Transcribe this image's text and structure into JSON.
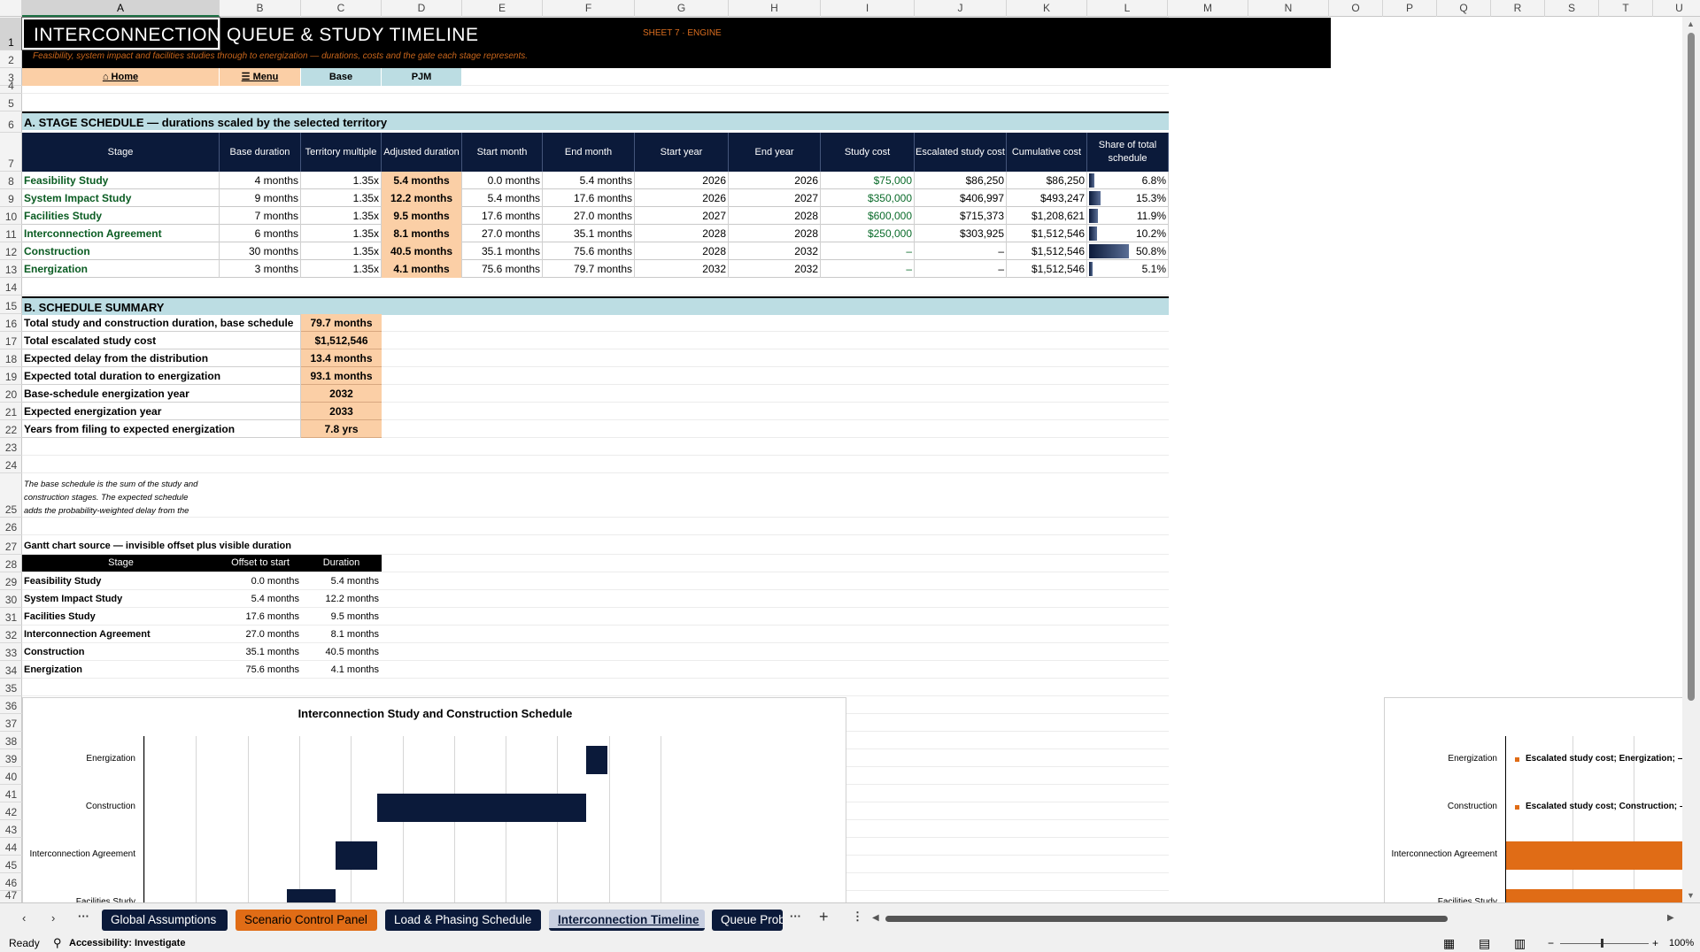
{
  "columns": [
    "A",
    "B",
    "C",
    "D",
    "E",
    "F",
    "G",
    "H",
    "I",
    "J",
    "K",
    "L",
    "M",
    "N",
    "O",
    "P",
    "Q",
    "R",
    "S",
    "T",
    "U"
  ],
  "rows": [
    "1",
    "2",
    "3",
    "4",
    "5",
    "6",
    "7",
    "8",
    "9",
    "10",
    "11",
    "12",
    "13",
    "14",
    "15",
    "16",
    "17",
    "18",
    "19",
    "20",
    "21",
    "22",
    "23",
    "24",
    "25",
    "26",
    "27",
    "28",
    "29",
    "30",
    "31",
    "32",
    "33",
    "34",
    "35",
    "36",
    "37",
    "38",
    "39",
    "40",
    "41",
    "42",
    "43",
    "44",
    "45",
    "46",
    "47"
  ],
  "header": {
    "title": "INTERCONNECTION QUEUE & STUDY TIMELINE",
    "subtitle": "Feasibility, system impact and facilities studies through to energization — durations, costs and the gate each stage represents.",
    "sheet_tag": "SHEET 7 · ENGINE"
  },
  "nav": {
    "home": "⌂ Home",
    "menu": "☰ Menu",
    "scenario": "Base",
    "territory": "PJM"
  },
  "sectionA": {
    "title": "A. STAGE SCHEDULE  —  durations scaled by the selected territory",
    "headers": [
      "Stage",
      "Base duration",
      "Territory multiple",
      "Adjusted duration",
      "Start month",
      "End month",
      "Start year",
      "End year",
      "Study cost",
      "Escalated study cost",
      "Cumulative cost",
      "Share of total schedule"
    ],
    "rows": [
      {
        "stage": "Feasibility Study",
        "base": "4 months",
        "mult": "1.35x",
        "adj": "5.4 months",
        "start": "0.0 months",
        "end": "5.4 months",
        "sy": "2026",
        "ey": "2026",
        "cost": "$75,000",
        "esc": "$86,250",
        "cum": "$86,250",
        "share": "6.8%",
        "share_val": 0.068
      },
      {
        "stage": "System Impact Study",
        "base": "9 months",
        "mult": "1.35x",
        "adj": "12.2 months",
        "start": "5.4 months",
        "end": "17.6 months",
        "sy": "2026",
        "ey": "2027",
        "cost": "$350,000",
        "esc": "$406,997",
        "cum": "$493,247",
        "share": "15.3%",
        "share_val": 0.153
      },
      {
        "stage": "Facilities Study",
        "base": "7 months",
        "mult": "1.35x",
        "adj": "9.5 months",
        "start": "17.6 months",
        "end": "27.0 months",
        "sy": "2027",
        "ey": "2028",
        "cost": "$600,000",
        "esc": "$715,373",
        "cum": "$1,208,621",
        "share": "11.9%",
        "share_val": 0.119
      },
      {
        "stage": "Interconnection Agreement",
        "base": "6 months",
        "mult": "1.35x",
        "adj": "8.1 months",
        "start": "27.0 months",
        "end": "35.1 months",
        "sy": "2028",
        "ey": "2028",
        "cost": "$250,000",
        "esc": "$303,925",
        "cum": "$1,512,546",
        "share": "10.2%",
        "share_val": 0.102
      },
      {
        "stage": "Construction",
        "base": "30 months",
        "mult": "1.35x",
        "adj": "40.5 months",
        "start": "35.1 months",
        "end": "75.6 months",
        "sy": "2028",
        "ey": "2032",
        "cost": "–",
        "esc": "–",
        "cum": "$1,512,546",
        "share": "50.8%",
        "share_val": 0.508
      },
      {
        "stage": "Energization",
        "base": "3 months",
        "mult": "1.35x",
        "adj": "4.1 months",
        "start": "75.6 months",
        "end": "79.7 months",
        "sy": "2032",
        "ey": "2032",
        "cost": "–",
        "esc": "–",
        "cum": "$1,512,546",
        "share": "5.1%",
        "share_val": 0.051
      }
    ]
  },
  "sectionB": {
    "title": "B. SCHEDULE SUMMARY",
    "rows": [
      {
        "label": "Total study and construction duration, base schedule",
        "value": "79.7 months"
      },
      {
        "label": "Total escalated study cost",
        "value": "$1,512,546"
      },
      {
        "label": "Expected delay from the distribution",
        "value": "13.4 months"
      },
      {
        "label": "Expected total duration to energization",
        "value": "93.1 months"
      },
      {
        "label": "Base-schedule energization year",
        "value": "2032"
      },
      {
        "label": "Expected energization year",
        "value": "2033"
      },
      {
        "label": "Years from filing to expected energization",
        "value": "7.8 yrs"
      }
    ]
  },
  "note": {
    "line1": "The base schedule is the sum of the study and",
    "line2": "construction stages. The expected schedule",
    "line3": "adds the probability-weighted delay from the"
  },
  "gantt_source": {
    "title": "Gantt chart source — invisible offset plus visible duration",
    "headers": [
      "Stage",
      "Offset to start",
      "Duration"
    ],
    "rows": [
      {
        "stage": "Feasibility Study",
        "offset": "0.0 months",
        "dur": "5.4 months"
      },
      {
        "stage": "System Impact Study",
        "offset": "5.4 months",
        "dur": "12.2 months"
      },
      {
        "stage": "Facilities Study",
        "offset": "17.6 months",
        "dur": "9.5 months"
      },
      {
        "stage": "Interconnection Agreement",
        "offset": "27.0 months",
        "dur": "8.1 months"
      },
      {
        "stage": "Construction",
        "offset": "35.1 months",
        "dur": "40.5 months"
      },
      {
        "stage": "Energization",
        "offset": "75.6 months",
        "dur": "4.1 months"
      }
    ]
  },
  "chart_data": [
    {
      "type": "bar",
      "title": "Interconnection Study and Construction Schedule",
      "orientation": "horizontal-stacked-gantt",
      "categories": [
        "Energization",
        "Construction",
        "Interconnection Agreement",
        "Facilities Study"
      ],
      "offsets": [
        75.6,
        35.1,
        27.0,
        17.6
      ],
      "values": [
        4.1,
        40.5,
        8.1,
        9.5
      ],
      "xlim": [
        -10,
        90
      ],
      "grid": "vertical"
    },
    {
      "type": "bar",
      "orientation": "horizontal",
      "categories": [
        "Energization",
        "Construction",
        "Interconnection Agreement",
        "Facilities Study"
      ],
      "labels": [
        "Escalated study cost; Energization; –",
        "Escalated study cost; Construction; –",
        "",
        ""
      ],
      "values": [
        0,
        0,
        303925,
        715373
      ]
    }
  ],
  "sheet_tabs": [
    "Global Assumptions",
    "Scenario Control Panel",
    "Load & Phasing Schedule",
    "Interconnection Timeline",
    "Queue Prob"
  ],
  "status": {
    "ready": "Ready",
    "accessibility": "Accessibility: Investigate",
    "zoom": "100%"
  },
  "colors": {
    "navy": "#0b1a3a",
    "orange": "#e06c16",
    "peach": "#fbcfa6",
    "teal": "#bcdde3"
  }
}
